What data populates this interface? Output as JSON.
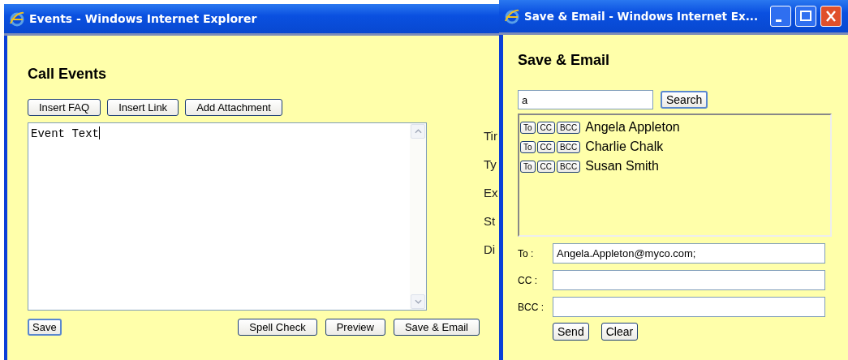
{
  "main_window": {
    "title": "Events - Windows Internet Explorer",
    "heading": "Call Events",
    "toolbar_buttons": [
      "Insert FAQ",
      "Insert Link",
      "Add Attachment"
    ],
    "event_text": "Event Text",
    "field_labels": [
      "Tir",
      "Ty",
      "Ex",
      "St",
      "Di"
    ],
    "footer_buttons": [
      {
        "label": "Save",
        "default": true
      },
      {
        "label": "Spell Check",
        "default": false
      },
      {
        "label": "Preview",
        "default": false
      },
      {
        "label": "Save & Email",
        "default": false
      }
    ]
  },
  "popup_window": {
    "title": "Save & Email - Windows Internet Ex...",
    "heading": "Save & Email",
    "search": {
      "value": "a",
      "button": "Search"
    },
    "contacts": [
      {
        "name": "Angela Appleton",
        "buttons": [
          "To",
          "CC",
          "BCC"
        ]
      },
      {
        "name": "Charlie Chalk",
        "buttons": [
          "To",
          "CC",
          "BCC"
        ]
      },
      {
        "name": "Susan Smith",
        "buttons": [
          "To",
          "CC",
          "BCC"
        ]
      }
    ],
    "fields": [
      {
        "label": "To :",
        "value": "Angela.Appleton@myco.com;"
      },
      {
        "label": "CC :"
      },
      {
        "label": "BCC :"
      }
    ],
    "buttons": [
      "Send",
      "Clear"
    ]
  }
}
